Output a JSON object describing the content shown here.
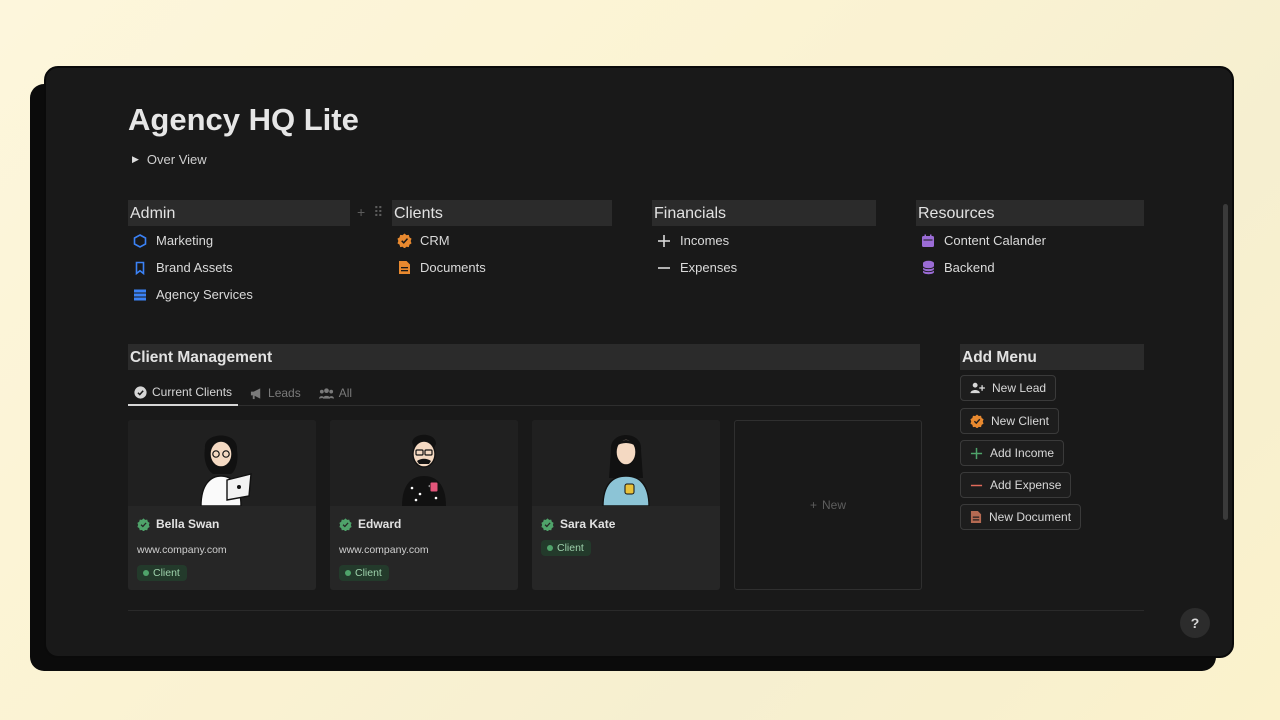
{
  "page": {
    "title": "Agency HQ Lite",
    "toggle_label": "Over View"
  },
  "columns": [
    {
      "header": "Admin",
      "items": [
        {
          "label": "Marketing",
          "icon": "hexagon-icon"
        },
        {
          "label": "Brand Assets",
          "icon": "bookmark-icon"
        },
        {
          "label": "Agency Services",
          "icon": "list-stack-icon"
        }
      ]
    },
    {
      "header": "Clients",
      "items": [
        {
          "label": "CRM",
          "icon": "verified-badge-icon"
        },
        {
          "label": "Documents",
          "icon": "document-icon"
        }
      ]
    },
    {
      "header": "Financials",
      "items": [
        {
          "label": "Incomes",
          "icon": "plus-icon"
        },
        {
          "label": "Expenses",
          "icon": "minus-icon"
        }
      ]
    },
    {
      "header": "Resources",
      "items": [
        {
          "label": "Content Calander",
          "icon": "calendar-icon"
        },
        {
          "label": "Backend",
          "icon": "database-icon"
        }
      ]
    }
  ],
  "client_management": {
    "header": "Client Management",
    "tabs": [
      {
        "label": "Current Clients",
        "icon": "check-badge-icon",
        "active": true
      },
      {
        "label": "Leads",
        "icon": "megaphone-icon",
        "active": false
      },
      {
        "label": "All",
        "icon": "people-icon",
        "active": false
      }
    ],
    "cards": [
      {
        "name": "Bella Swan",
        "website": "www.company.com",
        "status": "Client"
      },
      {
        "name": "Edward",
        "website": "www.company.com",
        "status": "Client"
      },
      {
        "name": "Sara Kate",
        "website": "",
        "status": "Client"
      }
    ],
    "new_label": "New"
  },
  "add_menu": {
    "header": "Add Menu",
    "buttons": [
      {
        "label": "New Lead",
        "icon": "add-person-icon"
      },
      {
        "label": "New Client",
        "icon": "verified-badge-icon"
      },
      {
        "label": "Add Income",
        "icon": "plus-icon"
      },
      {
        "label": "Add Expense",
        "icon": "minus-icon"
      },
      {
        "label": "New Document",
        "icon": "document-icon"
      }
    ]
  },
  "help": {
    "label": "?"
  },
  "colors": {
    "background": "#191919",
    "header_bg": "#2b2b2b",
    "accent_blue": "#3b82f6",
    "accent_orange": "#e8892f",
    "accent_purple": "#9b6cd6",
    "accent_green": "#4fa36a",
    "accent_red": "#e06a5a"
  }
}
